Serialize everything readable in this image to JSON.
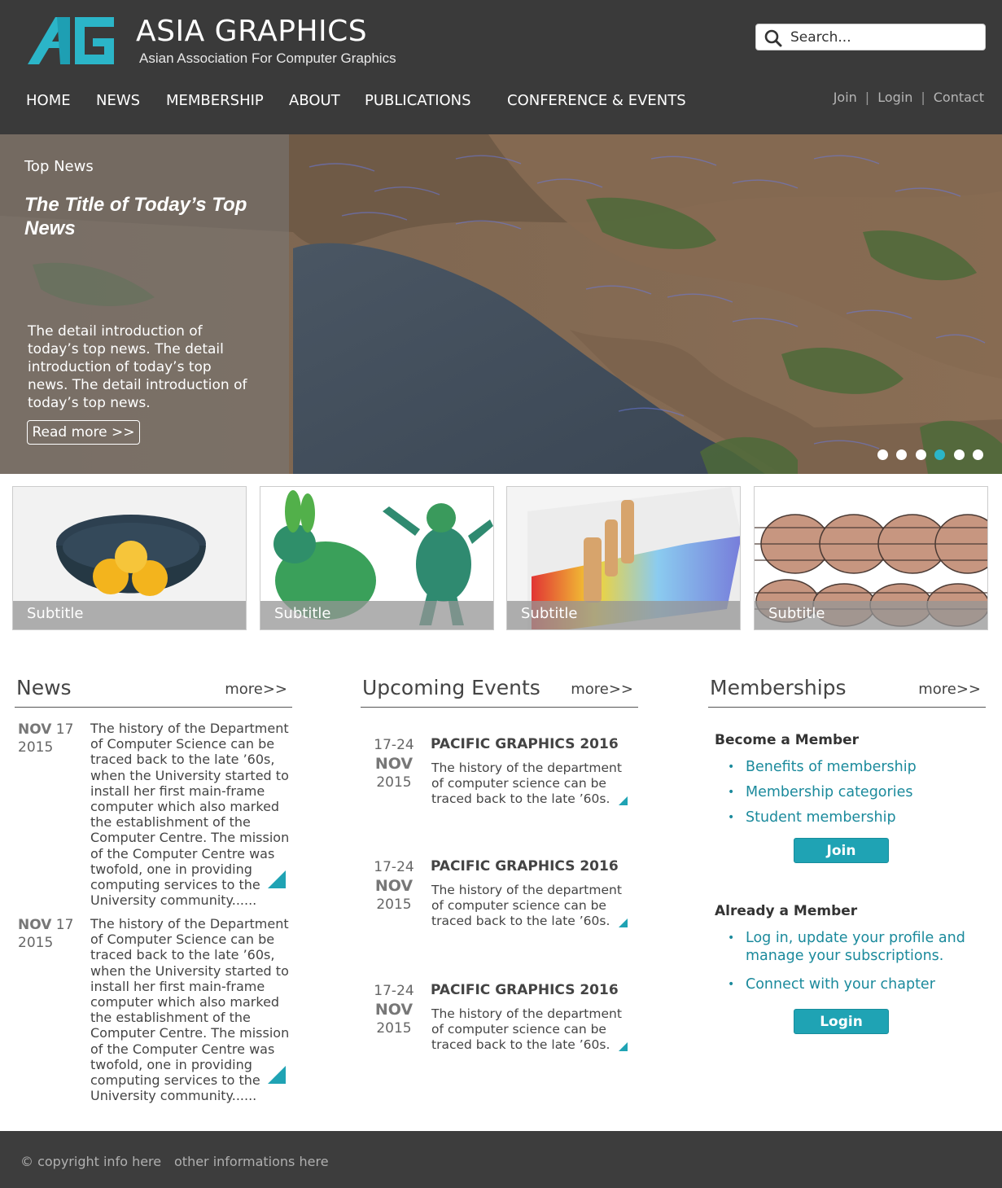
{
  "brand": {
    "title": "ASIA GRAPHICS",
    "subtitle": "Asian Association For Computer Graphics",
    "accent": "#2bb5c8"
  },
  "search": {
    "placeholder": "Search...",
    "icon": "search-icon"
  },
  "nav": {
    "items": [
      {
        "label": "HOME"
      },
      {
        "label": "NEWS"
      },
      {
        "label": "MEMBERSHIP"
      },
      {
        "label": "ABOUT"
      },
      {
        "label": "PUBLICATIONS"
      },
      {
        "label": "CONFERENCE & EVENTS"
      }
    ],
    "utility": {
      "join": "Join",
      "login": "Login",
      "contact": "Contact",
      "separator": "|"
    }
  },
  "hero": {
    "kicker": "Top News",
    "title": "The Title of  Today’s Top News",
    "text": "The detail introduction of today’s top news. The detail introduction of today’s top news. The detail introduction of today’s top news.",
    "button": "Read more >>",
    "slides_total": 6,
    "active_slide": 4
  },
  "thumbnails": [
    {
      "caption": "Subtitle"
    },
    {
      "caption": "Subtitle"
    },
    {
      "caption": "Subtitle"
    },
    {
      "caption": "Subtitle"
    }
  ],
  "news": {
    "title": "News",
    "more": "more>>",
    "items": [
      {
        "month": "NOV",
        "day": "17",
        "year": "2015",
        "text": "The history of the Department of Computer Science can be traced back to the late ’60s, when the University started to install her first main-frame computer which also marked the establishment of the Computer Centre. The mission of the Computer Centre was twofold, one in providing computing services to the University community......"
      },
      {
        "month": "NOV",
        "day": "17",
        "year": "2015",
        "text": "The history of the Department of Computer Science can be traced back to the late ’60s, when the University started to install her first main-frame computer which also marked the establishment of the Computer Centre. The mission of the Computer Centre was twofold, one in providing computing services to the University community......"
      }
    ]
  },
  "events": {
    "title": "Upcoming Events",
    "more": "more>>",
    "items": [
      {
        "days": "17-24",
        "month": "NOV",
        "year": "2015",
        "title": "PACIFIC GRAPHICS 2016",
        "text": "The history of the department of computer science can be traced back to the late ’60s."
      },
      {
        "days": "17-24",
        "month": "NOV",
        "year": "2015",
        "title": "PACIFIC GRAPHICS 2016",
        "text": "The history of the department of computer science can be traced back to the late ’60s."
      },
      {
        "days": "17-24",
        "month": "NOV",
        "year": "2015",
        "title": "PACIFIC GRAPHICS 2016",
        "text": "The history of the department of computer science can be traced back to the late ’60s."
      }
    ]
  },
  "memberships": {
    "title": "Memberships",
    "more": "more>>",
    "become": {
      "heading": "Become a Member",
      "links": [
        "Benefits of membership",
        "Membership categories",
        "Student membership"
      ],
      "button": "Join"
    },
    "already": {
      "heading": "Already a Member",
      "links": [
        "Log in, update your profile and manage your subscriptions.",
        "Connect with your chapter"
      ],
      "button": "Login"
    }
  },
  "footer": {
    "copyright": "© copyright info here",
    "other": "other informations here"
  },
  "colors": {
    "header_bg": "#3a3a3a",
    "teal": "#1fa3b4",
    "link": "#1b8a9c",
    "footer_bg": "#3d3d3d"
  }
}
